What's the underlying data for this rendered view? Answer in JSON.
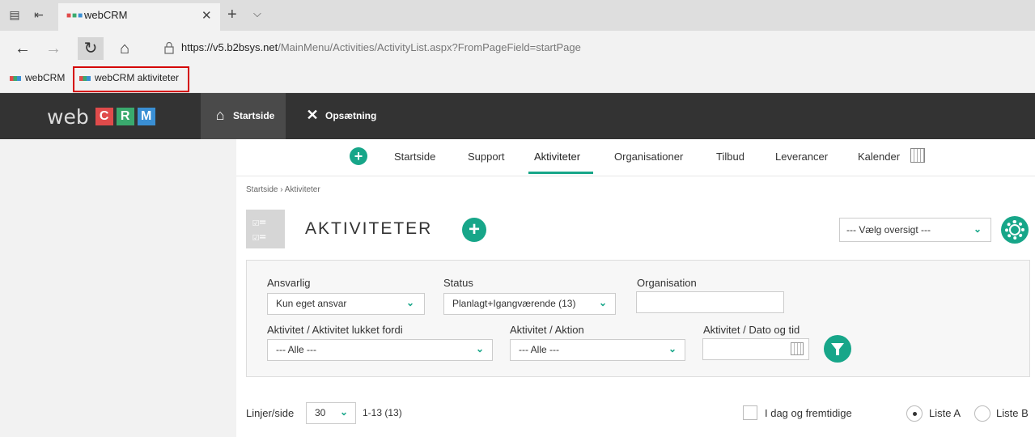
{
  "browser": {
    "tab_title": "webCRM",
    "url_host": "https://v5.b2bsys.net",
    "url_path": "/MainMenu/Activities/ActivityList.aspx?FromPageField=startPage",
    "favorites": [
      "webCRM",
      "webCRM aktiviteter"
    ]
  },
  "app": {
    "logo_text": "web",
    "logo_letters": [
      "C",
      "R",
      "M"
    ],
    "logo_colors": [
      "#e04b4b",
      "#3aaa6e",
      "#3a8fd4"
    ],
    "nav": [
      "Startside",
      "Opsætning"
    ]
  },
  "subnav": {
    "items": [
      "Startside",
      "Support",
      "Aktiviteter",
      "Organisationer",
      "Tilbud",
      "Leverancer",
      "Kalender"
    ],
    "active": "Aktiviteter"
  },
  "breadcrumb": "Startside  ›  Aktiviteter",
  "page": {
    "title": "AKTIVITETER",
    "view_select": "--- Vælg oversigt ---"
  },
  "filters": {
    "responsible_label": "Ansvarlig",
    "responsible_value": "Kun eget ansvar",
    "status_label": "Status",
    "status_value": "Planlagt+Igangværende (13)",
    "organisation_label": "Organisation",
    "organisation_value": "",
    "closed_label": "Aktivitet / Aktivitet lukket fordi",
    "closed_value": "--- Alle ---",
    "action_label": "Aktivitet / Aktion",
    "action_value": "--- Alle ---",
    "date_label": "Aktivitet / Dato og tid",
    "date_value": ""
  },
  "list": {
    "lines_label": "Linjer/side",
    "lines_value": "30",
    "count": "1-13 (13)",
    "today_future_label": "I dag og fremtidige",
    "list_a": "Liste A",
    "list_b": "Liste B"
  },
  "colors": {
    "accent": "#17a689",
    "header_bg": "#333333",
    "highlight": "#d40000"
  }
}
